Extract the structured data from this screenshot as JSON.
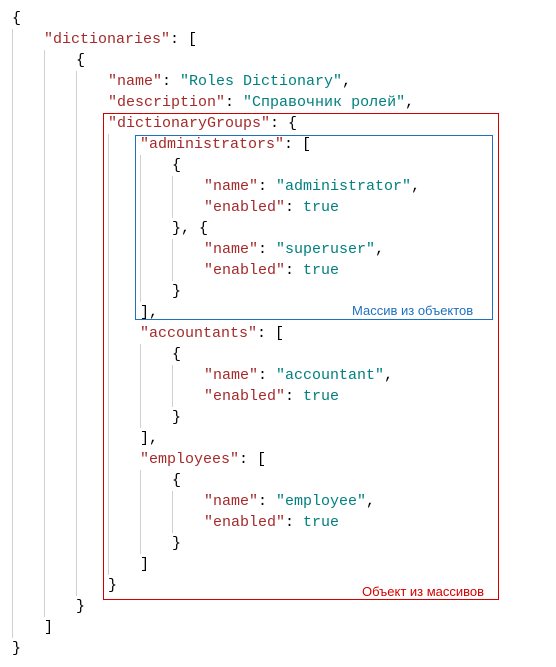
{
  "keys": {
    "dictionaries": "\"dictionaries\"",
    "name": "\"name\"",
    "description": "\"description\"",
    "dictionaryGroups": "\"dictionaryGroups\"",
    "administrators": "\"administrators\"",
    "accountants": "\"accountants\"",
    "employees": "\"employees\"",
    "enabled": "\"enabled\""
  },
  "values": {
    "rolesDict": "\"Roles Dictionary\"",
    "rolesDesc": "\"Справочник ролей\"",
    "administrator": "\"administrator\"",
    "superuser": "\"superuser\"",
    "accountant": "\"accountant\"",
    "employee": "\"employee\"",
    "true": "true"
  },
  "punct": {
    "openBrace": "{",
    "closeBrace": "}",
    "openBracket": "[",
    "closeBracket": "]",
    "colon": ": ",
    "comma": ",",
    "closeBraceCommaOpen": "}, {"
  },
  "annotations": {
    "arrayOfObjects": "Массив из объектов",
    "objectOfArrays": "Объект из массивов"
  },
  "chart_data": {
    "type": "table",
    "title": "Annotated JSON example with highlighted regions",
    "json_structure": {
      "dictionaries": [
        {
          "name": "Roles Dictionary",
          "description": "Справочник ролей",
          "dictionaryGroups": {
            "administrators": [
              {
                "name": "administrator",
                "enabled": true
              },
              {
                "name": "superuser",
                "enabled": true
              }
            ],
            "accountants": [
              {
                "name": "accountant",
                "enabled": true
              }
            ],
            "employees": [
              {
                "name": "employee",
                "enabled": true
              }
            ]
          }
        }
      ]
    },
    "highlights": [
      {
        "region": "administrators array (key + 2 objects)",
        "label": "Массив из объектов",
        "color": "blue"
      },
      {
        "region": "dictionaryGroups object (key + 3 arrays)",
        "label": "Объект из массивов",
        "color": "red"
      }
    ]
  }
}
